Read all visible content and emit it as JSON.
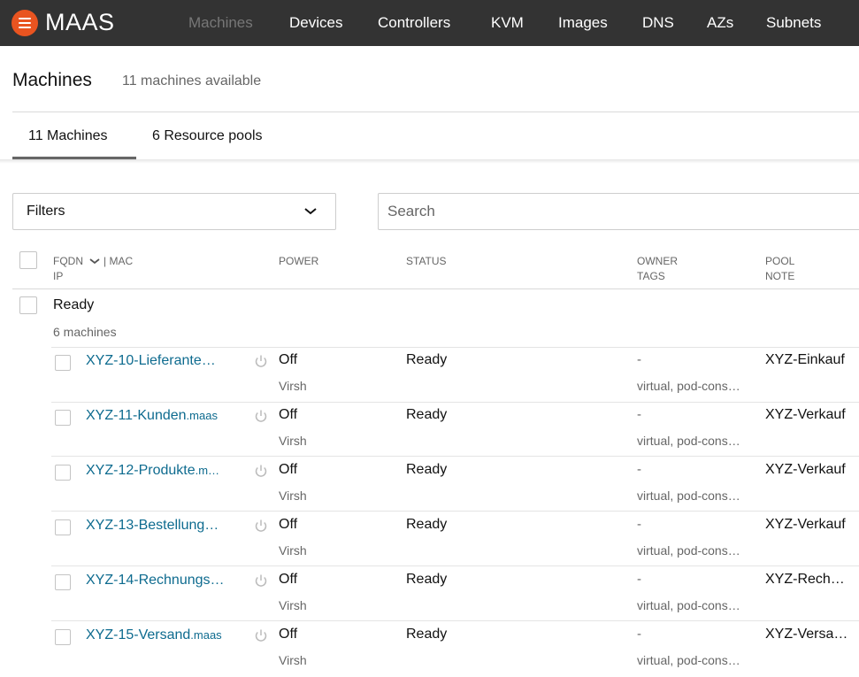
{
  "app": {
    "name": "MAAS",
    "logo_icon": "maas-logo-icon"
  },
  "nav": {
    "items": [
      {
        "label": "Machines",
        "active": true
      },
      {
        "label": "Devices"
      },
      {
        "label": "Controllers"
      },
      {
        "label": "KVM"
      },
      {
        "label": "Images"
      },
      {
        "label": "DNS"
      },
      {
        "label": "AZs"
      },
      {
        "label": "Subnets"
      }
    ]
  },
  "header": {
    "title": "Machines",
    "subtitle": "11 machines available"
  },
  "tabs": [
    {
      "label": "11 Machines",
      "active": true
    },
    {
      "label": "6 Resource pools"
    }
  ],
  "controls": {
    "filters_label": "Filters",
    "search_placeholder": "Search"
  },
  "table": {
    "headers": {
      "fqdn": "FQDN",
      "mac": "| MAC",
      "ip": "IP",
      "power": "POWER",
      "status": "STATUS",
      "owner": "OWNER",
      "tags": "TAGS",
      "pool": "POOL",
      "note": "NOTE"
    },
    "group": {
      "name": "Ready",
      "count": "6 machines"
    },
    "rows": [
      {
        "name": "XYZ-10-Lieferante…",
        "domain": "",
        "power": "Off",
        "power_type": "Virsh",
        "status": "Ready",
        "owner": "-",
        "tags": "virtual, pod-cons…",
        "pool": "XYZ-Einkauf"
      },
      {
        "name": "XYZ-11-Kunden",
        "domain": ".maas",
        "power": "Off",
        "power_type": "Virsh",
        "status": "Ready",
        "owner": "-",
        "tags": "virtual, pod-cons…",
        "pool": "XYZ-Verkauf"
      },
      {
        "name": "XYZ-12-Produkte",
        "domain": ".m…",
        "power": "Off",
        "power_type": "Virsh",
        "status": "Ready",
        "owner": "-",
        "tags": "virtual, pod-cons…",
        "pool": "XYZ-Verkauf"
      },
      {
        "name": "XYZ-13-Bestellung…",
        "domain": "",
        "power": "Off",
        "power_type": "Virsh",
        "status": "Ready",
        "owner": "-",
        "tags": "virtual, pod-cons…",
        "pool": "XYZ-Verkauf"
      },
      {
        "name": "XYZ-14-Rechnungs…",
        "domain": "",
        "power": "Off",
        "power_type": "Virsh",
        "status": "Ready",
        "owner": "-",
        "tags": "virtual, pod-cons…",
        "pool": "XYZ-Rech…"
      },
      {
        "name": "XYZ-15-Versand",
        "domain": ".maas",
        "power": "Off",
        "power_type": "Virsh",
        "status": "Ready",
        "owner": "-",
        "tags": "virtual, pod-cons…",
        "pool": "XYZ-Versa…"
      }
    ]
  },
  "colors": {
    "nav_bg": "#333333",
    "brand": "#e95420",
    "link": "#0e6b8f",
    "muted": "#666666"
  }
}
